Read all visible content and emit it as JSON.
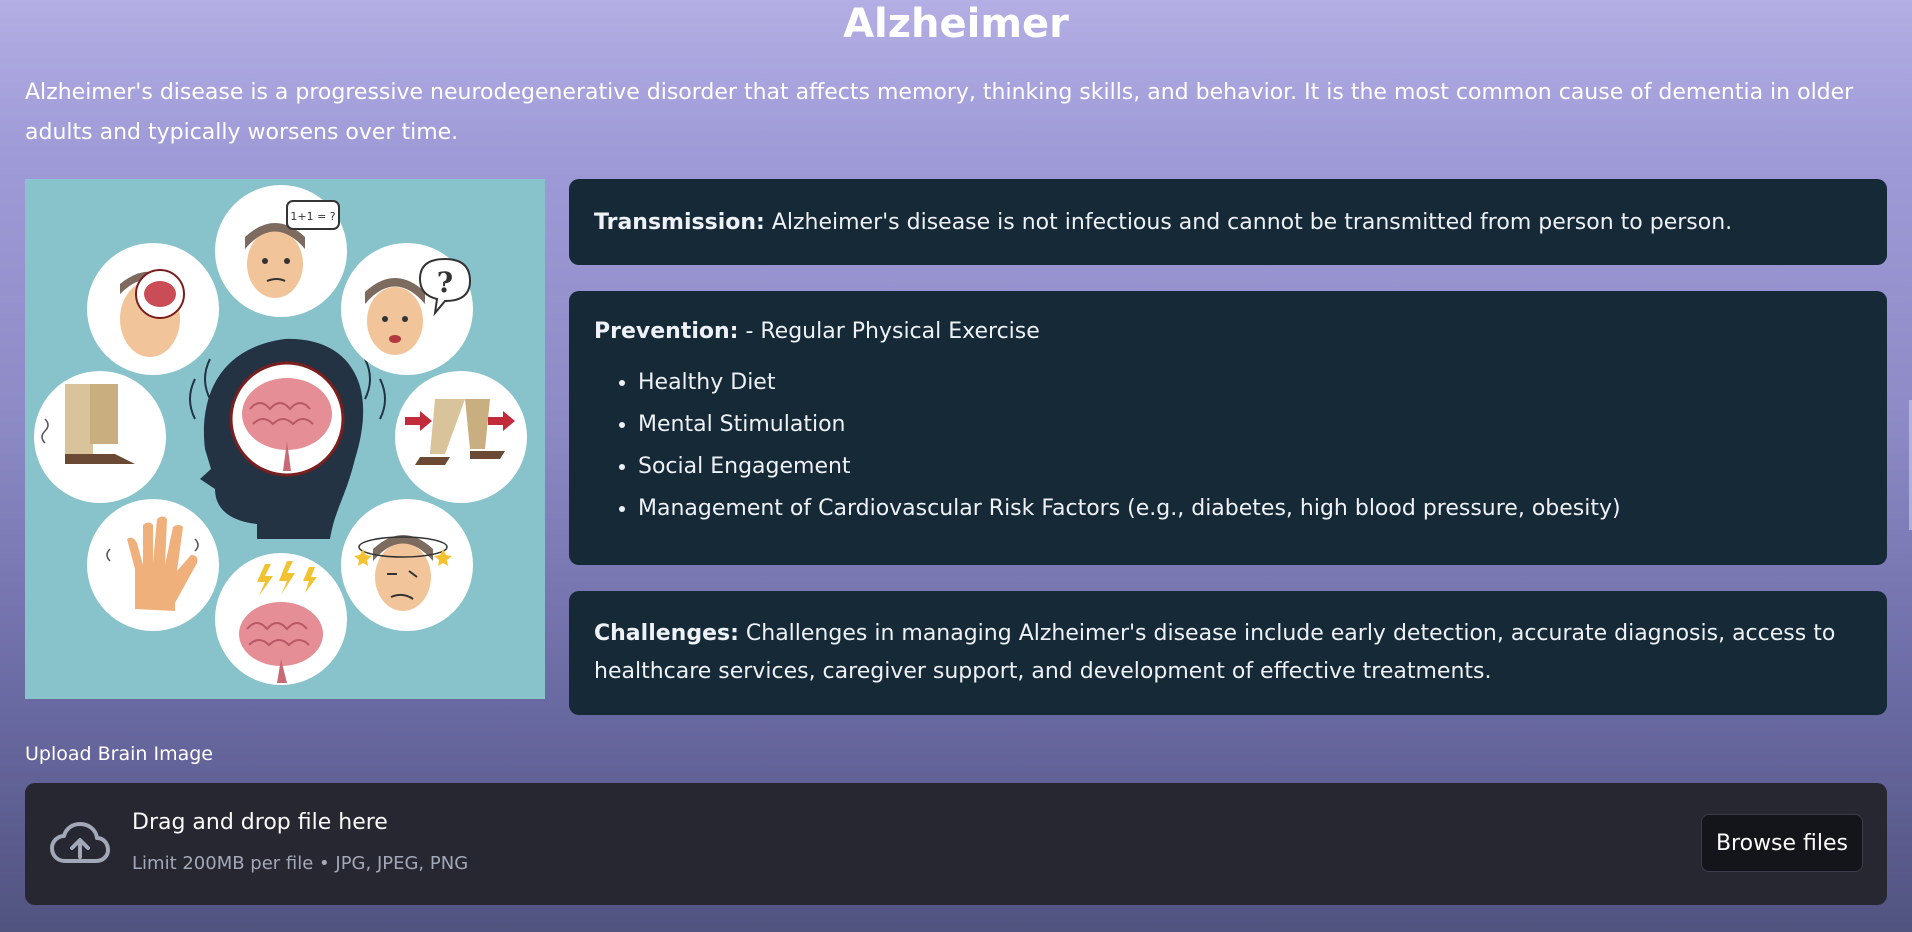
{
  "page": {
    "title": "Alzheimer",
    "intro": "Alzheimer's disease is a progressive neurodegenerative disorder that affects memory, thinking skills, and behavior. It is the most common cause of dementia in older adults and typically worsens over time."
  },
  "illustration": {
    "bubble_math": "1+1 = ?",
    "bubble_question": "?"
  },
  "cards": {
    "transmission": {
      "label": "Transmission:",
      "text": "Alzheimer's disease is not infectious and cannot be transmitted from person to person."
    },
    "prevention": {
      "label": "Prevention:",
      "first": "- Regular Physical Exercise",
      "items": [
        "Healthy Diet",
        "Mental Stimulation",
        "Social Engagement",
        "Management of Cardiovascular Risk Factors (e.g., diabetes, high blood pressure, obesity)"
      ]
    },
    "challenges": {
      "label": "Challenges:",
      "text": "Challenges in managing Alzheimer's disease include early detection, accurate diagnosis, access to healthcare services, caregiver support, and development of effective treatments."
    }
  },
  "upload": {
    "label": "Upload Brain Image",
    "drop_title": "Drag and drop file here",
    "limit": "Limit 200MB per file • JPG, JPEG, PNG",
    "browse": "Browse files",
    "icon": "cloud-upload-icon"
  },
  "colors": {
    "card_bg": "#152937",
    "dropzone_bg": "#262730",
    "image_bg": "#88c3cc",
    "page_gradient_top": "#b3aee3",
    "page_gradient_bottom": "#51537f"
  }
}
